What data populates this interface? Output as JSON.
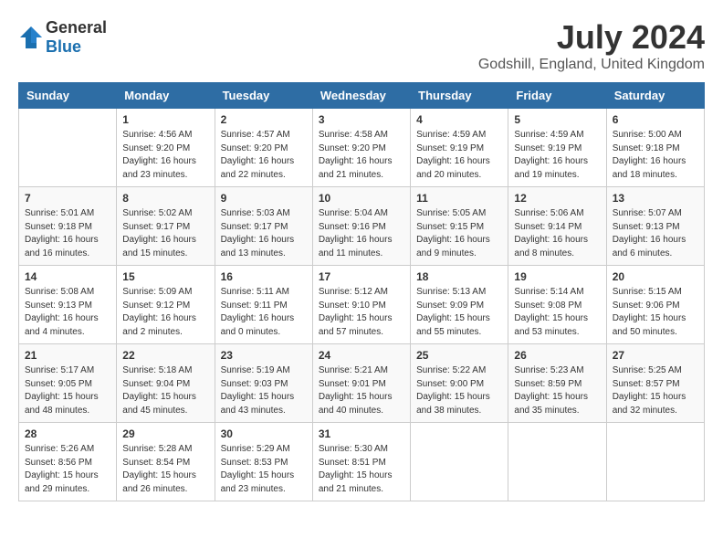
{
  "header": {
    "logo_general": "General",
    "logo_blue": "Blue",
    "month": "July 2024",
    "location": "Godshill, England, United Kingdom"
  },
  "weekdays": [
    "Sunday",
    "Monday",
    "Tuesday",
    "Wednesday",
    "Thursday",
    "Friday",
    "Saturday"
  ],
  "weeks": [
    [
      {
        "day": "",
        "sunrise": "",
        "sunset": "",
        "daylight": ""
      },
      {
        "day": "1",
        "sunrise": "Sunrise: 4:56 AM",
        "sunset": "Sunset: 9:20 PM",
        "daylight": "Daylight: 16 hours and 23 minutes."
      },
      {
        "day": "2",
        "sunrise": "Sunrise: 4:57 AM",
        "sunset": "Sunset: 9:20 PM",
        "daylight": "Daylight: 16 hours and 22 minutes."
      },
      {
        "day": "3",
        "sunrise": "Sunrise: 4:58 AM",
        "sunset": "Sunset: 9:20 PM",
        "daylight": "Daylight: 16 hours and 21 minutes."
      },
      {
        "day": "4",
        "sunrise": "Sunrise: 4:59 AM",
        "sunset": "Sunset: 9:19 PM",
        "daylight": "Daylight: 16 hours and 20 minutes."
      },
      {
        "day": "5",
        "sunrise": "Sunrise: 4:59 AM",
        "sunset": "Sunset: 9:19 PM",
        "daylight": "Daylight: 16 hours and 19 minutes."
      },
      {
        "day": "6",
        "sunrise": "Sunrise: 5:00 AM",
        "sunset": "Sunset: 9:18 PM",
        "daylight": "Daylight: 16 hours and 18 minutes."
      }
    ],
    [
      {
        "day": "7",
        "sunrise": "Sunrise: 5:01 AM",
        "sunset": "Sunset: 9:18 PM",
        "daylight": "Daylight: 16 hours and 16 minutes."
      },
      {
        "day": "8",
        "sunrise": "Sunrise: 5:02 AM",
        "sunset": "Sunset: 9:17 PM",
        "daylight": "Daylight: 16 hours and 15 minutes."
      },
      {
        "day": "9",
        "sunrise": "Sunrise: 5:03 AM",
        "sunset": "Sunset: 9:17 PM",
        "daylight": "Daylight: 16 hours and 13 minutes."
      },
      {
        "day": "10",
        "sunrise": "Sunrise: 5:04 AM",
        "sunset": "Sunset: 9:16 PM",
        "daylight": "Daylight: 16 hours and 11 minutes."
      },
      {
        "day": "11",
        "sunrise": "Sunrise: 5:05 AM",
        "sunset": "Sunset: 9:15 PM",
        "daylight": "Daylight: 16 hours and 9 minutes."
      },
      {
        "day": "12",
        "sunrise": "Sunrise: 5:06 AM",
        "sunset": "Sunset: 9:14 PM",
        "daylight": "Daylight: 16 hours and 8 minutes."
      },
      {
        "day": "13",
        "sunrise": "Sunrise: 5:07 AM",
        "sunset": "Sunset: 9:13 PM",
        "daylight": "Daylight: 16 hours and 6 minutes."
      }
    ],
    [
      {
        "day": "14",
        "sunrise": "Sunrise: 5:08 AM",
        "sunset": "Sunset: 9:13 PM",
        "daylight": "Daylight: 16 hours and 4 minutes."
      },
      {
        "day": "15",
        "sunrise": "Sunrise: 5:09 AM",
        "sunset": "Sunset: 9:12 PM",
        "daylight": "Daylight: 16 hours and 2 minutes."
      },
      {
        "day": "16",
        "sunrise": "Sunrise: 5:11 AM",
        "sunset": "Sunset: 9:11 PM",
        "daylight": "Daylight: 16 hours and 0 minutes."
      },
      {
        "day": "17",
        "sunrise": "Sunrise: 5:12 AM",
        "sunset": "Sunset: 9:10 PM",
        "daylight": "Daylight: 15 hours and 57 minutes."
      },
      {
        "day": "18",
        "sunrise": "Sunrise: 5:13 AM",
        "sunset": "Sunset: 9:09 PM",
        "daylight": "Daylight: 15 hours and 55 minutes."
      },
      {
        "day": "19",
        "sunrise": "Sunrise: 5:14 AM",
        "sunset": "Sunset: 9:08 PM",
        "daylight": "Daylight: 15 hours and 53 minutes."
      },
      {
        "day": "20",
        "sunrise": "Sunrise: 5:15 AM",
        "sunset": "Sunset: 9:06 PM",
        "daylight": "Daylight: 15 hours and 50 minutes."
      }
    ],
    [
      {
        "day": "21",
        "sunrise": "Sunrise: 5:17 AM",
        "sunset": "Sunset: 9:05 PM",
        "daylight": "Daylight: 15 hours and 48 minutes."
      },
      {
        "day": "22",
        "sunrise": "Sunrise: 5:18 AM",
        "sunset": "Sunset: 9:04 PM",
        "daylight": "Daylight: 15 hours and 45 minutes."
      },
      {
        "day": "23",
        "sunrise": "Sunrise: 5:19 AM",
        "sunset": "Sunset: 9:03 PM",
        "daylight": "Daylight: 15 hours and 43 minutes."
      },
      {
        "day": "24",
        "sunrise": "Sunrise: 5:21 AM",
        "sunset": "Sunset: 9:01 PM",
        "daylight": "Daylight: 15 hours and 40 minutes."
      },
      {
        "day": "25",
        "sunrise": "Sunrise: 5:22 AM",
        "sunset": "Sunset: 9:00 PM",
        "daylight": "Daylight: 15 hours and 38 minutes."
      },
      {
        "day": "26",
        "sunrise": "Sunrise: 5:23 AM",
        "sunset": "Sunset: 8:59 PM",
        "daylight": "Daylight: 15 hours and 35 minutes."
      },
      {
        "day": "27",
        "sunrise": "Sunrise: 5:25 AM",
        "sunset": "Sunset: 8:57 PM",
        "daylight": "Daylight: 15 hours and 32 minutes."
      }
    ],
    [
      {
        "day": "28",
        "sunrise": "Sunrise: 5:26 AM",
        "sunset": "Sunset: 8:56 PM",
        "daylight": "Daylight: 15 hours and 29 minutes."
      },
      {
        "day": "29",
        "sunrise": "Sunrise: 5:28 AM",
        "sunset": "Sunset: 8:54 PM",
        "daylight": "Daylight: 15 hours and 26 minutes."
      },
      {
        "day": "30",
        "sunrise": "Sunrise: 5:29 AM",
        "sunset": "Sunset: 8:53 PM",
        "daylight": "Daylight: 15 hours and 23 minutes."
      },
      {
        "day": "31",
        "sunrise": "Sunrise: 5:30 AM",
        "sunset": "Sunset: 8:51 PM",
        "daylight": "Daylight: 15 hours and 21 minutes."
      },
      {
        "day": "",
        "sunrise": "",
        "sunset": "",
        "daylight": ""
      },
      {
        "day": "",
        "sunrise": "",
        "sunset": "",
        "daylight": ""
      },
      {
        "day": "",
        "sunrise": "",
        "sunset": "",
        "daylight": ""
      }
    ]
  ]
}
